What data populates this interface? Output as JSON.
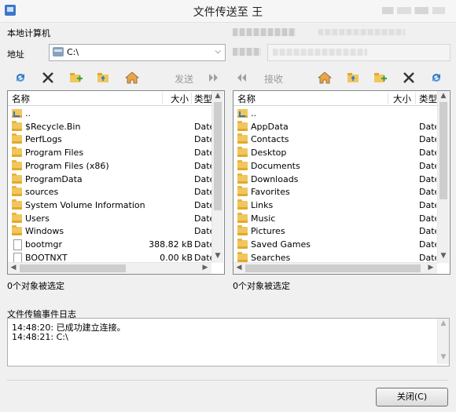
{
  "window": {
    "title": "文件传送至 王"
  },
  "local": {
    "heading": "本地计算机",
    "address_label": "地址",
    "address_value": "C:\\",
    "send_label": "发送",
    "header": {
      "name": "名称",
      "size": "大小",
      "type": "类型"
    },
    "files": [
      {
        "name": "..",
        "size": "",
        "type": "",
        "kind": "up"
      },
      {
        "name": "$Recycle.Bin",
        "size": "",
        "type": "Date",
        "kind": "folder"
      },
      {
        "name": "PerfLogs",
        "size": "",
        "type": "Date",
        "kind": "folder"
      },
      {
        "name": "Program Files",
        "size": "",
        "type": "Date",
        "kind": "folder"
      },
      {
        "name": "Program Files (x86)",
        "size": "",
        "type": "Date",
        "kind": "folder"
      },
      {
        "name": "ProgramData",
        "size": "",
        "type": "Date",
        "kind": "folder"
      },
      {
        "name": "sources",
        "size": "",
        "type": "Date",
        "kind": "folder"
      },
      {
        "name": "System Volume Information",
        "size": "",
        "type": "Date",
        "kind": "folder"
      },
      {
        "name": "Users",
        "size": "",
        "type": "Date",
        "kind": "folder"
      },
      {
        "name": "Windows",
        "size": "",
        "type": "Date",
        "kind": "folder"
      },
      {
        "name": "bootmgr",
        "size": "388.82 kB",
        "type": "Date",
        "kind": "file"
      },
      {
        "name": "BOOTNXT",
        "size": "0.00 kB",
        "type": "Date",
        "kind": "file"
      }
    ],
    "status": "0个对象被选定"
  },
  "remote": {
    "receive_label": "接收",
    "header": {
      "name": "名称",
      "size": "大小",
      "type": "类型"
    },
    "files": [
      {
        "name": "..",
        "size": "",
        "type": "",
        "kind": "up"
      },
      {
        "name": "AppData",
        "size": "",
        "type": "Date",
        "kind": "folder"
      },
      {
        "name": "Contacts",
        "size": "",
        "type": "Date",
        "kind": "folder"
      },
      {
        "name": "Desktop",
        "size": "",
        "type": "Date",
        "kind": "folder"
      },
      {
        "name": "Documents",
        "size": "",
        "type": "Date",
        "kind": "folder"
      },
      {
        "name": "Downloads",
        "size": "",
        "type": "Date",
        "kind": "folder"
      },
      {
        "name": "Favorites",
        "size": "",
        "type": "Date",
        "kind": "folder"
      },
      {
        "name": "Links",
        "size": "",
        "type": "Date",
        "kind": "folder"
      },
      {
        "name": "Music",
        "size": "",
        "type": "Date",
        "kind": "folder"
      },
      {
        "name": "Pictures",
        "size": "",
        "type": "Date",
        "kind": "folder"
      },
      {
        "name": "Saved Games",
        "size": "",
        "type": "Date",
        "kind": "folder"
      },
      {
        "name": "Searches",
        "size": "",
        "type": "Date",
        "kind": "folder"
      }
    ],
    "status": "0个对象被选定"
  },
  "log": {
    "heading": "文件传输事件日志",
    "lines": [
      "14:48:20: 已成功建立连接。",
      "14:48:21: C:\\"
    ]
  },
  "close_button": "关闭(C)",
  "icons": {
    "refresh": "refresh-icon",
    "delete": "delete-x-icon",
    "new_folder": "new-folder-icon",
    "up_folder": "parent-folder-icon",
    "home": "home-icon",
    "send": "double-right-arrow-icon",
    "receive": "double-left-arrow-icon"
  },
  "colors": {
    "folder": "#f0c75e",
    "refresh": "#2f7ac4",
    "delete": "#333333",
    "disabled_text": "#9a9a9a"
  }
}
